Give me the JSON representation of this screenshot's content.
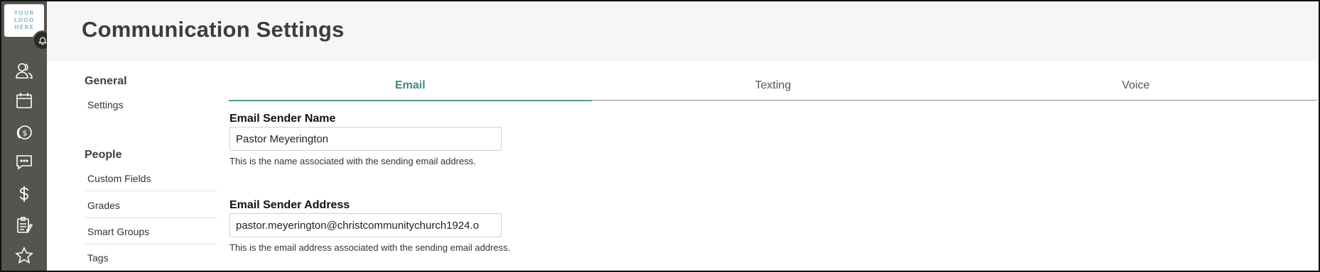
{
  "logo": {
    "lines": [
      "YOUR",
      "LOGO",
      "HERE"
    ]
  },
  "rail": {
    "icons": [
      "people-icon",
      "calendar-icon",
      "giving-icon",
      "messages-icon",
      "dollar-icon",
      "forms-icon",
      "star-icon"
    ]
  },
  "header": {
    "title": "Communication Settings"
  },
  "nav": {
    "general": {
      "title": "General",
      "items": [
        "Settings"
      ]
    },
    "people": {
      "title": "People",
      "items": [
        "Custom Fields",
        "Grades",
        "Smart Groups",
        "Tags"
      ]
    }
  },
  "tabs": [
    {
      "label": "Email",
      "active": true
    },
    {
      "label": "Texting",
      "active": false
    },
    {
      "label": "Voice",
      "active": false
    }
  ],
  "form": {
    "sender_name": {
      "label": "Email Sender Name",
      "value": "Pastor Meyerington",
      "help": "This is the name associated with the sending email address."
    },
    "sender_address": {
      "label": "Email Sender Address",
      "value": "pastor.meyerington@christcommunitychurch1924.o",
      "help": "This is the email address associated with the sending email address."
    }
  },
  "colors": {
    "rail": "#55554f",
    "accent": "#4d9b93",
    "header_bg": "#f6f6f6"
  }
}
